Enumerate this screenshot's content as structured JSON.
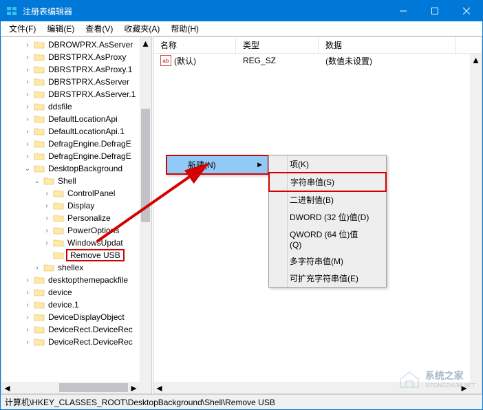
{
  "title": "注册表编辑器",
  "menubar": [
    "文件(F)",
    "编辑(E)",
    "查看(V)",
    "收藏夹(A)",
    "帮助(H)"
  ],
  "tree": [
    {
      "d": 2,
      "e": ">",
      "l": "DBROWPRX.AsServer"
    },
    {
      "d": 2,
      "e": ">",
      "l": "DBRSTPRX.AsProxy"
    },
    {
      "d": 2,
      "e": ">",
      "l": "DBRSTPRX.AsProxy.1"
    },
    {
      "d": 2,
      "e": ">",
      "l": "DBRSTPRX.AsServer"
    },
    {
      "d": 2,
      "e": ">",
      "l": "DBRSTPRX.AsServer.1"
    },
    {
      "d": 2,
      "e": ">",
      "l": "ddsfile"
    },
    {
      "d": 2,
      "e": ">",
      "l": "DefaultLocationApi"
    },
    {
      "d": 2,
      "e": ">",
      "l": "DefaultLocationApi.1"
    },
    {
      "d": 2,
      "e": ">",
      "l": "DefragEngine.DefragE"
    },
    {
      "d": 2,
      "e": ">",
      "l": "DefragEngine.DefragE"
    },
    {
      "d": 2,
      "e": "v",
      "l": "DesktopBackground"
    },
    {
      "d": 3,
      "e": "v",
      "l": "Shell"
    },
    {
      "d": 4,
      "e": ">",
      "l": "ControlPanel"
    },
    {
      "d": 4,
      "e": ">",
      "l": "Display"
    },
    {
      "d": 4,
      "e": ">",
      "l": "Personalize"
    },
    {
      "d": 4,
      "e": ">",
      "l": "PowerOptions"
    },
    {
      "d": 4,
      "e": ">",
      "l": "WindowsUpdat"
    },
    {
      "d": 4,
      "e": "",
      "l": "Remove USB",
      "sel": true
    },
    {
      "d": 3,
      "e": ">",
      "l": "shellex"
    },
    {
      "d": 2,
      "e": ">",
      "l": "desktopthemepackfile"
    },
    {
      "d": 2,
      "e": ">",
      "l": "device"
    },
    {
      "d": 2,
      "e": ">",
      "l": "device.1"
    },
    {
      "d": 2,
      "e": ">",
      "l": "DeviceDisplayObject"
    },
    {
      "d": 2,
      "e": ">",
      "l": "DeviceRect.DeviceRec"
    },
    {
      "d": 2,
      "e": ">",
      "l": "DeviceRect.DeviceRec"
    }
  ],
  "columns": {
    "name": "名称",
    "type": "类型",
    "data": "数据"
  },
  "col_widths": {
    "name": 120,
    "type": 120,
    "data": 200
  },
  "rows": [
    {
      "name": "(默认)",
      "type": "REG_SZ",
      "data": "(数值未设置)"
    }
  ],
  "context_primary": {
    "label": "新建(N)"
  },
  "context_sub": [
    {
      "label": "项(K)"
    },
    {
      "label": "字符串值(S)",
      "boxed": true
    },
    {
      "label": "二进制值(B)"
    },
    {
      "label": "DWORD (32 位)值(D)"
    },
    {
      "label": "QWORD (64 位)值(Q)"
    },
    {
      "label": "多字符串值(M)"
    },
    {
      "label": "可扩充字符串值(E)"
    }
  ],
  "statusbar": "计算机\\HKEY_CLASSES_ROOT\\DesktopBackground\\Shell\\Remove USB",
  "watermark_text": "系统之家",
  "watermark_url": "XITONGZHIJIA.NET"
}
